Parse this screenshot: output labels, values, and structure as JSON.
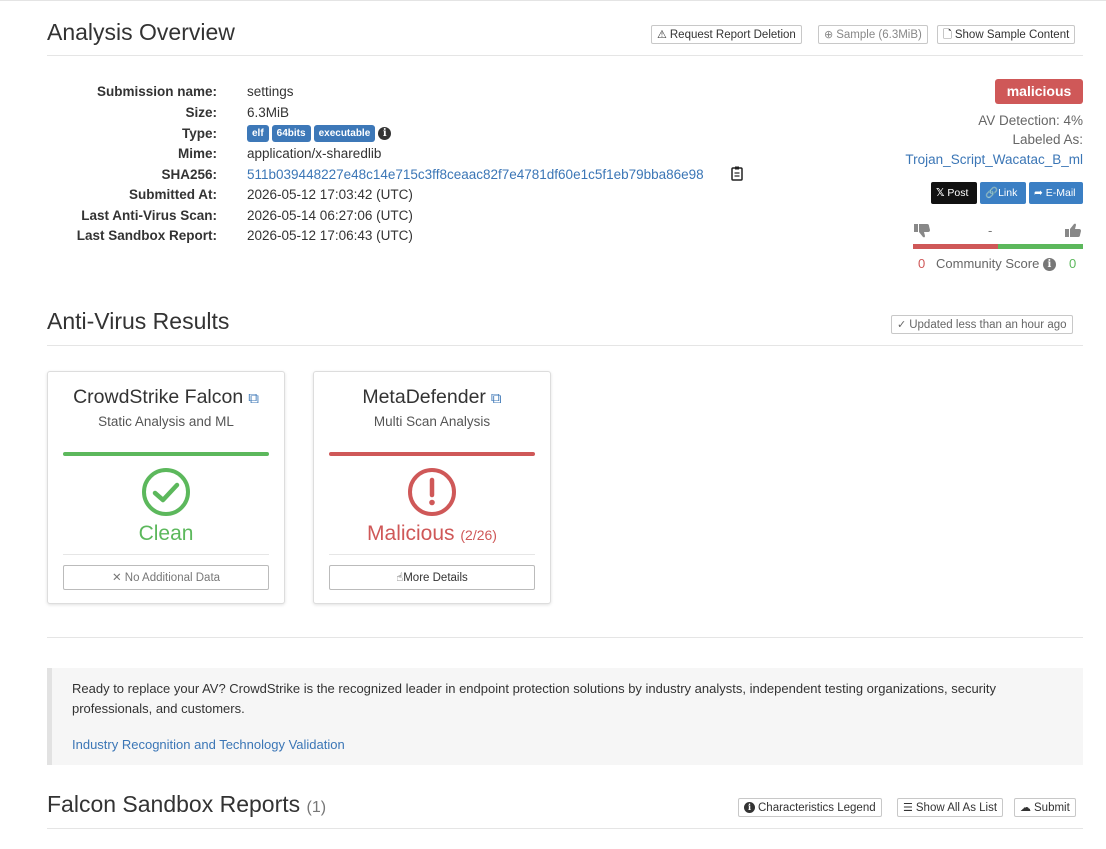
{
  "overview": {
    "title": "Analysis Overview",
    "buttons": {
      "request_deletion": "Request Report Deletion",
      "sample": "Sample (6.3MiB)",
      "show_sample_content": "Show Sample Content"
    },
    "labels": {
      "submission_name": "Submission name:",
      "size": "Size:",
      "type": "Type:",
      "mime": "Mime:",
      "sha256": "SHA256:",
      "submitted_at": "Submitted At:",
      "last_av_scan": "Last Anti-Virus Scan:",
      "last_sandbox": "Last Sandbox Report:"
    },
    "values": {
      "submission_name": "settings",
      "size": "6.3MiB",
      "type_tags": [
        "elf",
        "64bits",
        "executable"
      ],
      "mime": "application/x-sharedlib",
      "sha256": "511b039448227e48c14e715c3ff8ceaac82f7e4781df60e1c5f1eb79bba86e98",
      "submitted_at": "2026-05-12 17:03:42 (UTC)",
      "last_av_scan": "2026-05-14 06:27:06 (UTC)",
      "last_sandbox": "2026-05-12 17:06:43 (UTC)"
    },
    "verdict": {
      "badge": "malicious",
      "av_detection": "AV Detection: 4%",
      "labeled_as": "Labeled As:",
      "label_link": "Trojan_Script_Wacatac_B_ml"
    },
    "share": {
      "post": "Post",
      "link": "Link",
      "email": "E-Mail",
      "x_glyph": "𝕏"
    },
    "community": {
      "dash": "-",
      "down_count": "0",
      "up_count": "0",
      "label": "Community Score"
    }
  },
  "av": {
    "title": "Anti-Virus Results",
    "updated": "Updated less than an hour ago",
    "cards": [
      {
        "name": "CrowdStrike Falcon",
        "subtitle": "Static Analysis and ML",
        "result": "Clean",
        "result_detail": "",
        "button": "No Additional Data",
        "color": "#5cb85c"
      },
      {
        "name": "MetaDefender",
        "subtitle": "Multi Scan Analysis",
        "result": "Malicious",
        "result_detail": "(2/26)",
        "button": "More Details",
        "color": "#cf5858"
      }
    ]
  },
  "callout": {
    "text": "Ready to replace your AV? CrowdStrike is the recognized leader in endpoint protection solutions by industry analysts, independent testing organizations, security professionals, and customers.",
    "link": "Industry Recognition and Technology Validation"
  },
  "sandbox": {
    "title": "Falcon Sandbox Reports",
    "count": "(1)",
    "buttons": {
      "legend": "Characteristics Legend",
      "show_all": "Show All As List",
      "submit": "Submit"
    }
  },
  "colors": {
    "accent_link": "#3b76b6",
    "malicious": "#cf5858",
    "clean": "#5cb85c",
    "tag": "#3d78b8"
  }
}
